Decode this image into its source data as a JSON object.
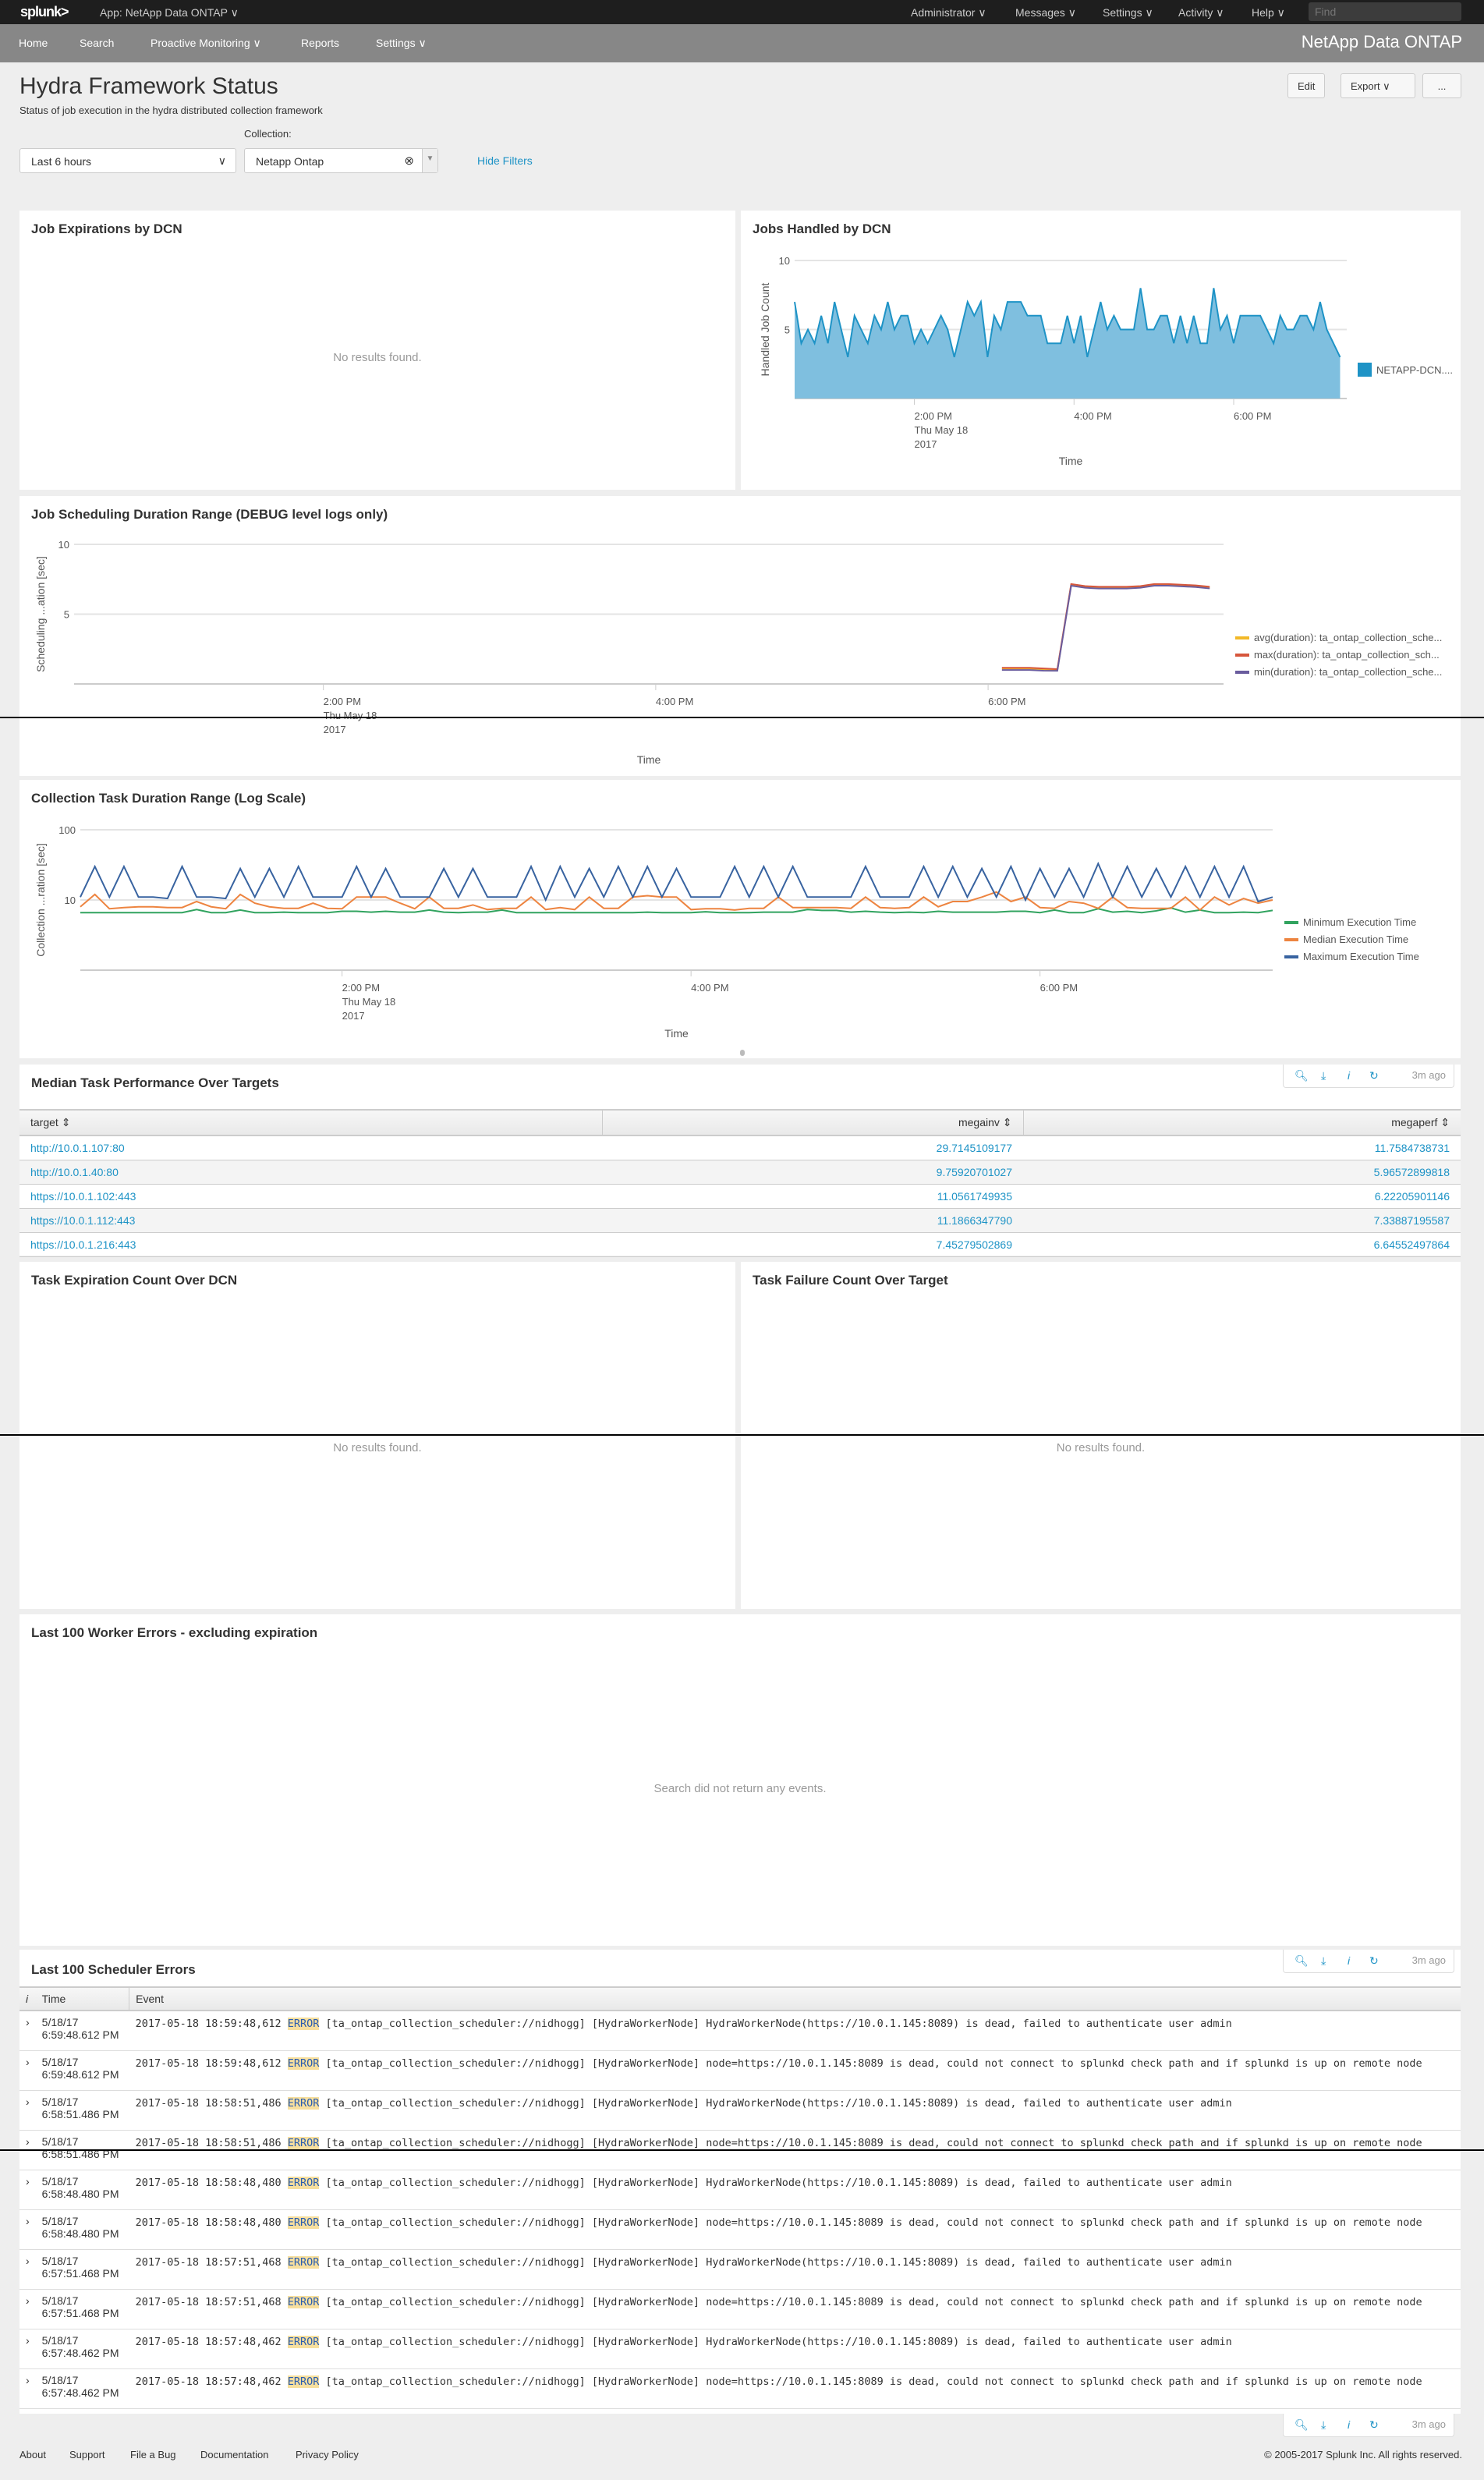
{
  "topbar": {
    "logo": "splunk>",
    "app": "App: NetApp Data ONTAP ∨",
    "menus": [
      "Administrator ∨",
      "Messages ∨",
      "Settings ∨",
      "Activity ∨",
      "Help ∨"
    ],
    "find_placeholder": "Find"
  },
  "navbar": {
    "items": [
      "Home",
      "Search",
      "Proactive Monitoring ∨",
      "Reports",
      "Settings ∨"
    ],
    "brand": "NetApp Data ONTAP"
  },
  "page": {
    "title": "Hydra Framework Status",
    "subtitle": "Status of job execution in the hydra distributed collection framework",
    "edit": "Edit",
    "export": "Export ∨",
    "more": "..."
  },
  "filters": {
    "time": "Last 6 hours",
    "collection_label": "Collection:",
    "collection": "Netapp Ontap",
    "hide": "Hide Filters"
  },
  "panels": {
    "job_expirations": {
      "title": "Job Expirations by DCN",
      "empty": "No results found."
    },
    "jobs_handled": {
      "title": "Jobs Handled by DCN"
    },
    "job_scheduling": {
      "title": "Job Scheduling Duration Range (DEBUG level logs only)"
    },
    "collection_task": {
      "title": "Collection Task Duration Range (Log Scale)"
    },
    "median_task": {
      "title": "Median Task Performance Over Targets",
      "columns": [
        "target ⇕",
        "megainv ⇕",
        "megaperf ⇕"
      ],
      "rows": [
        [
          "http://10.0.1.107:80",
          "29.7145109177",
          "11.7584738731"
        ],
        [
          "http://10.0.1.40:80",
          "9.75920701027",
          "5.96572899818"
        ],
        [
          "https://10.0.1.102:443",
          "11.0561749935",
          "6.22205901146"
        ],
        [
          "https://10.0.1.112:443",
          "11.1866347790",
          "7.33887195587"
        ],
        [
          "https://10.0.1.216:443",
          "7.45279502869",
          "6.64552497864"
        ]
      ]
    },
    "task_expiration": {
      "title": "Task Expiration Count Over DCN",
      "empty": "No results found."
    },
    "task_failure": {
      "title": "Task Failure Count Over Target",
      "empty": "No results found."
    },
    "worker_errors": {
      "title": "Last 100 Worker Errors - excluding expiration",
      "empty": "Search did not return any events."
    },
    "scheduler_errors": {
      "title": "Last 100 Scheduler Errors",
      "columns": [
        "i",
        "Time",
        "Event"
      ],
      "rows": [
        {
          "date": "5/18/17",
          "time": "6:59:48.612 PM",
          "ts": "2017-05-18 18:59:48,612",
          "level": "ERROR",
          "msg": "[ta_ontap_collection_scheduler://nidhogg] [HydraWorkerNode] HydraWorkerNode(https://10.0.1.145:8089) is dead, failed to authenticate user admin"
        },
        {
          "date": "5/18/17",
          "time": "6:59:48.612 PM",
          "ts": "2017-05-18 18:59:48,612",
          "level": "ERROR",
          "msg": "[ta_ontap_collection_scheduler://nidhogg] [HydraWorkerNode] node=https://10.0.1.145:8089 is dead, could not connect to splunkd check path and if splunkd is up on remote node"
        },
        {
          "date": "5/18/17",
          "time": "6:58:51.486 PM",
          "ts": "2017-05-18 18:58:51,486",
          "level": "ERROR",
          "msg": "[ta_ontap_collection_scheduler://nidhogg] [HydraWorkerNode] HydraWorkerNode(https://10.0.1.145:8089) is dead, failed to authenticate user admin"
        },
        {
          "date": "5/18/17",
          "time": "6:58:51.486 PM",
          "ts": "2017-05-18 18:58:51,486",
          "level": "ERROR",
          "msg": "[ta_ontap_collection_scheduler://nidhogg] [HydraWorkerNode] node=https://10.0.1.145:8089 is dead, could not connect to splunkd check path and if splunkd is up on remote node"
        },
        {
          "date": "5/18/17",
          "time": "6:58:48.480 PM",
          "ts": "2017-05-18 18:58:48,480",
          "level": "ERROR",
          "msg": "[ta_ontap_collection_scheduler://nidhogg] [HydraWorkerNode] HydraWorkerNode(https://10.0.1.145:8089) is dead, failed to authenticate user admin"
        },
        {
          "date": "5/18/17",
          "time": "6:58:48.480 PM",
          "ts": "2017-05-18 18:58:48,480",
          "level": "ERROR",
          "msg": "[ta_ontap_collection_scheduler://nidhogg] [HydraWorkerNode] node=https://10.0.1.145:8089 is dead, could not connect to splunkd check path and if splunkd is up on remote node"
        },
        {
          "date": "5/18/17",
          "time": "6:57:51.468 PM",
          "ts": "2017-05-18 18:57:51,468",
          "level": "ERROR",
          "msg": "[ta_ontap_collection_scheduler://nidhogg] [HydraWorkerNode] HydraWorkerNode(https://10.0.1.145:8089) is dead, failed to authenticate user admin"
        },
        {
          "date": "5/18/17",
          "time": "6:57:51.468 PM",
          "ts": "2017-05-18 18:57:51,468",
          "level": "ERROR",
          "msg": "[ta_ontap_collection_scheduler://nidhogg] [HydraWorkerNode] node=https://10.0.1.145:8089 is dead, could not connect to splunkd check path and if splunkd is up on remote node"
        },
        {
          "date": "5/18/17",
          "time": "6:57:48.462 PM",
          "ts": "2017-05-18 18:57:48,462",
          "level": "ERROR",
          "msg": "[ta_ontap_collection_scheduler://nidhogg] [HydraWorkerNode] HydraWorkerNode(https://10.0.1.145:8089) is dead, failed to authenticate user admin"
        },
        {
          "date": "5/18/17",
          "time": "6:57:48.462 PM",
          "ts": "2017-05-18 18:57:48,462",
          "level": "ERROR",
          "msg": "[ta_ontap_collection_scheduler://nidhogg] [HydraWorkerNode] node=https://10.0.1.145:8089 is dead, could not connect to splunkd check path and if splunkd is up on remote node"
        }
      ]
    }
  },
  "panel_tools": {
    "last_refresh": "3m ago",
    "icons": [
      "search-icon",
      "download-icon",
      "info-icon",
      "refresh-icon"
    ]
  },
  "footer": {
    "links": [
      "About",
      "Support",
      "File a Bug",
      "Documentation",
      "Privacy Policy"
    ],
    "copyright": "© 2005-2017 Splunk Inc. All rights reserved."
  },
  "chart_data": [
    {
      "type": "area",
      "ylabel": "Handled Job Count",
      "xlabel": "Time",
      "ylim": [
        0,
        10
      ],
      "yticks": [
        "10",
        "5"
      ],
      "xticks": [
        "2:00 PM",
        "4:00 PM",
        "6:00 PM"
      ],
      "xsub": [
        "Thu May 18",
        "2017"
      ],
      "x_start": "12:30 PM",
      "x_step_minutes": 5,
      "x_end": "7:20 PM",
      "grid": true,
      "legend": "right",
      "color": "#1e93c6",
      "series": [
        {
          "name": "NETAPP-DCN....",
          "values": [
            7,
            4,
            5,
            4,
            6,
            4,
            7,
            5,
            3,
            6,
            5,
            4,
            6,
            5,
            7,
            5,
            6,
            6,
            4,
            5,
            4,
            5,
            6,
            5,
            3,
            5,
            7,
            6,
            7,
            3,
            6,
            5,
            7,
            7,
            7,
            6,
            6,
            6,
            4,
            4,
            4,
            6,
            4,
            6,
            3,
            5,
            7,
            5,
            6,
            5,
            5,
            5,
            8,
            5,
            5,
            6,
            6,
            4,
            6,
            4,
            6,
            4,
            4,
            8,
            5,
            6,
            4,
            6,
            6,
            6,
            6,
            5,
            4,
            6,
            5,
            5,
            6,
            6,
            5,
            7,
            5,
            4,
            3
          ]
        }
      ]
    },
    {
      "type": "line",
      "ylabel": "Scheduling ...ation [sec]",
      "xlabel": "Time",
      "ylim": [
        0,
        10
      ],
      "yticks": [
        "10",
        "5"
      ],
      "xticks": [
        "2:00 PM",
        "4:00 PM",
        "6:00 PM"
      ],
      "xsub": [
        "Thu May 18",
        "2017"
      ],
      "x_range": [
        "12:30 PM",
        "7:25 PM"
      ],
      "x_start": "6:05 PM",
      "x_step_minutes": 5,
      "grid": true,
      "legend": "right",
      "series": [
        {
          "name": "avg(duration): ta_ontap_collection_sche...",
          "color": "#f2b827",
          "values": [
            1.1,
            1.1,
            1.1,
            1.05,
            1.0,
            7.1,
            6.95,
            6.9,
            6.9,
            6.9,
            6.95,
            7.1,
            7.1,
            7.05,
            7.0,
            6.9
          ]
        },
        {
          "name": "max(duration): ta_ontap_collection_sch...",
          "color": "#d6563c",
          "values": [
            1.16,
            1.16,
            1.16,
            1.11,
            1.06,
            7.16,
            7.01,
            6.96,
            6.96,
            6.96,
            7.01,
            7.16,
            7.16,
            7.11,
            7.06,
            6.96
          ]
        },
        {
          "name": "min(duration): ta_ontap_collection_sche...",
          "color": "#6a5c9e",
          "values": [
            1.0,
            1.0,
            1.0,
            0.95,
            0.94,
            7.04,
            6.89,
            6.84,
            6.84,
            6.84,
            6.89,
            7.04,
            7.04,
            6.99,
            6.94,
            6.84
          ]
        }
      ]
    },
    {
      "type": "line",
      "scale": "log",
      "ylabel": "Collection ...ration [sec]",
      "xlabel": "Time",
      "ylim": [
        1,
        100
      ],
      "yticks": [
        "100",
        "10"
      ],
      "xticks": [
        "2:00 PM",
        "4:00 PM",
        "6:00 PM"
      ],
      "xsub": [
        "Thu May 18",
        "2017"
      ],
      "x_start": "12:30 PM",
      "x_step_minutes": 5,
      "grid": true,
      "legend": "right",
      "series": [
        {
          "name": "Minimum Execution Time",
          "color": "#31a35f",
          "values": [
            6.6,
            6.6,
            6.6,
            6.6,
            6.6,
            6.6,
            6.6,
            6.6,
            7.3,
            6.6,
            6.6,
            7.2,
            6.6,
            6.6,
            6.7,
            6.6,
            6.6,
            6.6,
            6.9,
            6.9,
            6.7,
            6.9,
            6.7,
            6.7,
            7.2,
            6.7,
            6.6,
            6.7,
            6.7,
            7.2,
            6.6,
            6.6,
            6.6,
            6.6,
            6.6,
            6.6,
            6.6,
            6.6,
            6.6,
            6.7,
            6.6,
            6.6,
            6.6,
            6.8,
            6.6,
            6.6,
            6.6,
            6.7,
            6.7,
            6.7,
            7.3,
            7.1,
            7.1,
            6.7,
            6.9,
            6.7,
            6.6,
            6.7,
            6.6,
            6.9,
            6.7,
            6.7,
            6.7,
            6.7,
            6.9,
            6.9,
            6.6,
            7.2,
            6.6,
            6.6,
            7.5,
            6.7,
            6.9,
            6.6,
            7.0,
            7.7,
            6.7,
            7.2,
            6.6,
            6.6,
            6.7,
            6.6,
            7.1
          ]
        },
        {
          "name": "Median Execution Time",
          "color": "#ed8440",
          "values": [
            8,
            12,
            7.5,
            7.8,
            8,
            8,
            7.8,
            7.8,
            9.5,
            8,
            7.5,
            12,
            9,
            8,
            7.6,
            7.6,
            9,
            7.6,
            7.5,
            11,
            11,
            11,
            9,
            7.5,
            11,
            7.6,
            7.6,
            8.5,
            7.3,
            7.6,
            7.6,
            11,
            7.3,
            7.8,
            7.3,
            11,
            7.6,
            7.6,
            11,
            11.5,
            11,
            11,
            7.3,
            7.5,
            7.5,
            7.2,
            7.6,
            7.6,
            11,
            7.8,
            7.8,
            7.8,
            7.8,
            7.6,
            11,
            7.8,
            7.6,
            7.8,
            11,
            8,
            9.5,
            9.5,
            11,
            13,
            9.5,
            11,
            7.8,
            7.6,
            9.5,
            9,
            7.6,
            11,
            7.8,
            7.6,
            7.6,
            7.6,
            11,
            7.2,
            11,
            8.5,
            10.5,
            9,
            10
          ]
        },
        {
          "name": "Maximum Execution Time",
          "color": "#3863a0",
          "values": [
            11,
            30,
            11,
            30,
            11,
            11,
            10.5,
            30,
            11,
            11,
            10.5,
            28,
            11,
            28,
            11,
            30,
            11,
            11,
            11,
            30,
            11,
            28,
            11,
            11,
            11,
            28,
            11,
            28,
            11,
            11,
            11,
            30,
            10,
            30,
            11,
            28,
            11,
            30,
            11,
            30,
            11,
            28,
            11,
            11,
            11,
            30,
            11,
            30,
            11,
            30,
            11,
            11,
            11,
            11,
            30,
            11,
            11,
            11,
            30,
            11,
            30,
            11,
            28,
            11,
            30,
            10,
            28,
            11,
            28,
            11,
            33,
            11,
            30,
            11,
            28,
            11,
            30,
            11,
            30,
            11,
            30,
            9.5,
            11
          ]
        }
      ]
    }
  ]
}
